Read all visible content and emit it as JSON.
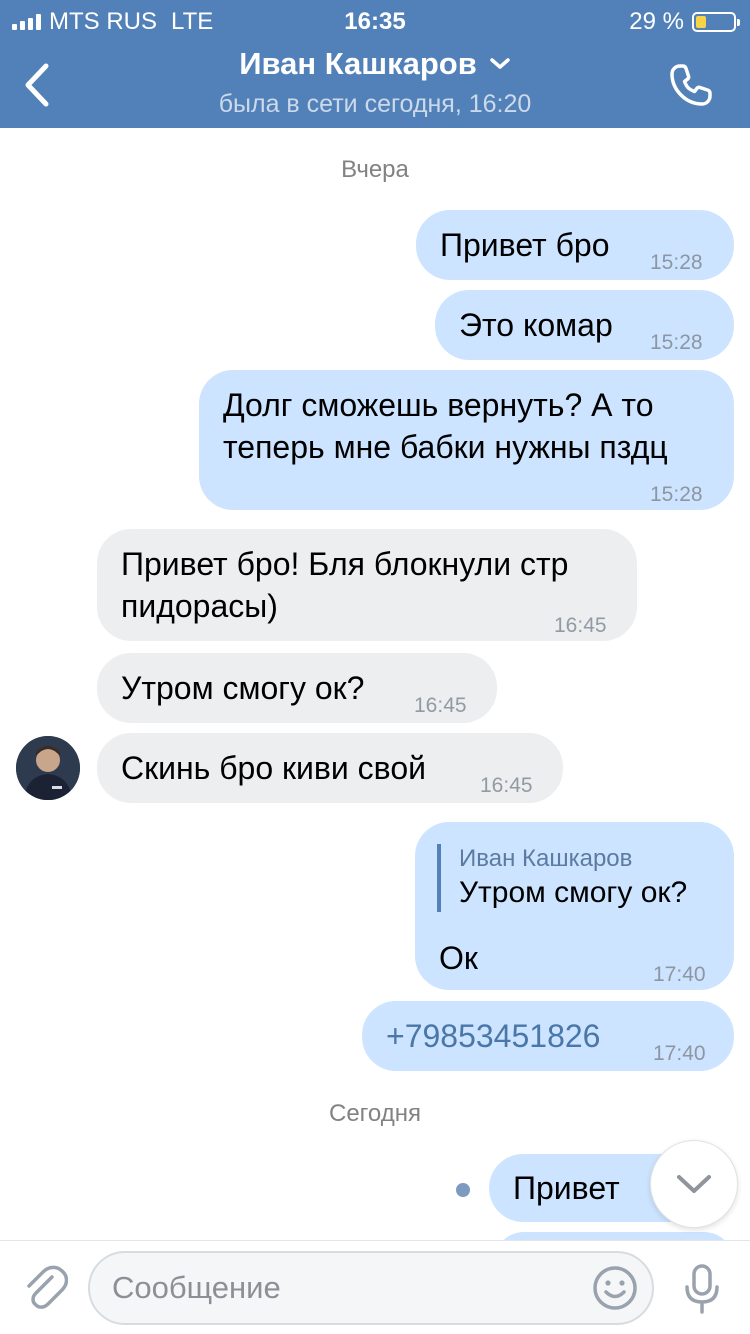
{
  "status_bar": {
    "carrier": "MTS RUS",
    "network": "LTE",
    "time": "16:35",
    "battery": "29 %",
    "battery_level": 0.29
  },
  "header": {
    "contact_name": "Иван Кашкаров",
    "last_seen": "была в сети сегодня, 16:20",
    "back_icon": "chevron-left-icon",
    "call_icon": "phone-icon"
  },
  "chat": {
    "date_yesterday": "Вчера",
    "date_today": "Сегодня",
    "messages": [
      {
        "direction": "out",
        "text": "Привет бро",
        "time": "15:28"
      },
      {
        "direction": "out",
        "text": "Это комар",
        "time": "15:28"
      },
      {
        "direction": "out",
        "text_line1": "Долг сможешь вернуть? А то",
        "text_line2": "теперь мне бабки нужны пздц",
        "time": "15:28"
      },
      {
        "direction": "in",
        "text_line1": "Привет бро! Бля блокнули стр",
        "text_line2": "пидорасы)",
        "time": "16:45"
      },
      {
        "direction": "in",
        "text": "Утром смогу ок?",
        "time": "16:45"
      },
      {
        "direction": "in",
        "text": "Скинь бро киви свой",
        "time": "16:45"
      },
      {
        "direction": "out",
        "reply_name": "Иван Кашкаров",
        "reply_text": "Утром смогу ок?",
        "text": "Ок",
        "time": "17:40"
      },
      {
        "direction": "out",
        "text": "+79853451826",
        "time": "17:40"
      },
      {
        "direction": "out",
        "text": "Привет",
        "time": ""
      }
    ]
  },
  "composer": {
    "placeholder": "Сообщение",
    "attach_icon": "paperclip-icon",
    "emoji_icon": "smiley-icon",
    "mic_icon": "microphone-icon"
  },
  "colors": {
    "header_bg": "#5181b8",
    "outgoing_bubble": "#cce4ff",
    "incoming_bubble": "#edeef0",
    "link": "#4a76a8"
  }
}
